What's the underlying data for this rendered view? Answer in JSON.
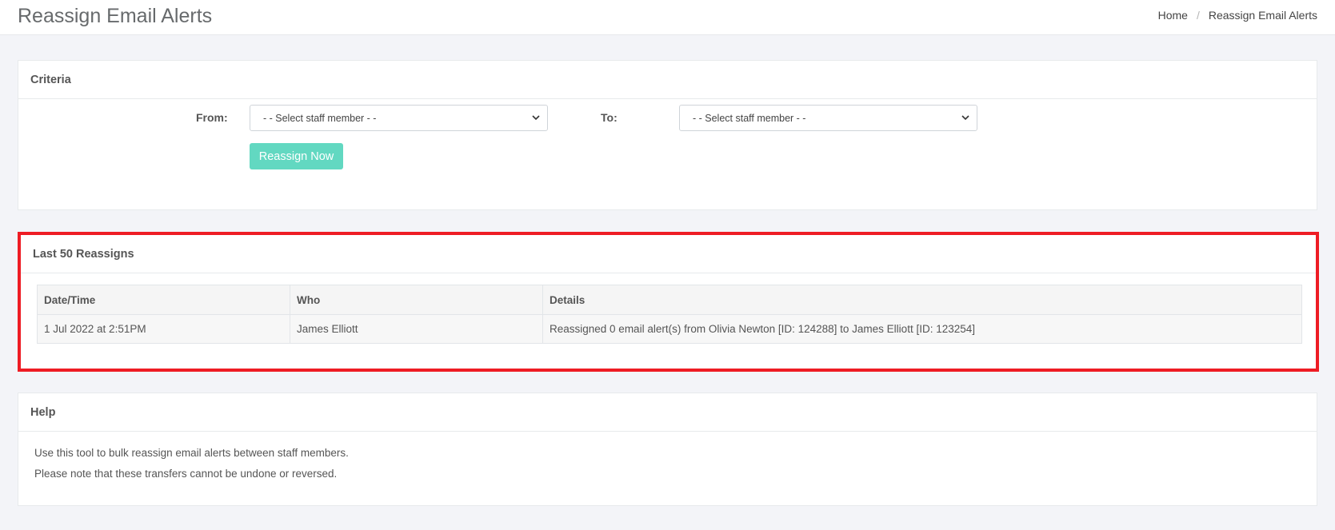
{
  "header": {
    "title": "Reassign Email Alerts",
    "breadcrumb": {
      "home": "Home",
      "separator": "/",
      "current": "Reassign Email Alerts"
    }
  },
  "criteria": {
    "title": "Criteria",
    "from_label": "From:",
    "from_value": "- - Select staff member - -",
    "to_label": "To:",
    "to_value": "- - Select staff member - -",
    "button_label": "Reassign Now"
  },
  "reassigns": {
    "title": "Last 50 Reassigns",
    "columns": [
      "Date/Time",
      "Who",
      "Details"
    ],
    "rows": [
      [
        "1 Jul 2022 at 2:51PM",
        "James Elliott",
        "Reassigned 0 email alert(s) from Olivia Newton [ID: 124288] to James Elliott [ID: 123254]"
      ]
    ]
  },
  "help": {
    "title": "Help",
    "lines": [
      "Use this tool to bulk reassign email alerts between staff members.",
      "Please note that these transfers cannot be undone or reversed."
    ]
  },
  "colors": {
    "accent_button": "#62d8c1",
    "highlight_border": "#ee1c24"
  },
  "icons": {
    "select_arrow": "chevron-down-icon"
  }
}
